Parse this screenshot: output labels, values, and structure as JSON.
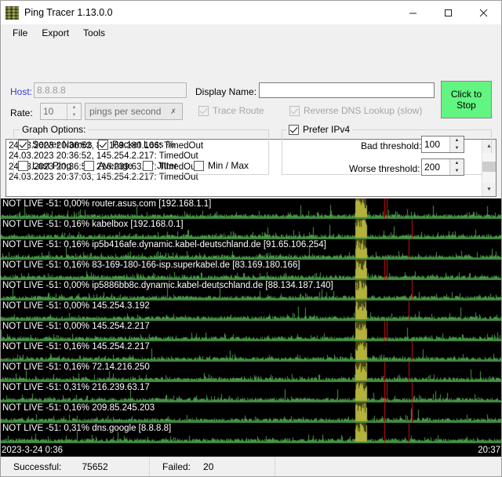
{
  "window": {
    "title": "Ping Tracer 1.13.0.0",
    "icon": "app-icon",
    "minimize_label": "minimize-icon",
    "maximize_label": "maximize-icon",
    "close_label": "close-icon"
  },
  "menu": {
    "items": [
      {
        "label": "File"
      },
      {
        "label": "Export"
      },
      {
        "label": "Tools"
      }
    ]
  },
  "form": {
    "host_label": "Host:",
    "host_value": "8.8.8.8",
    "host_placeholder": "",
    "rate_label": "Rate:",
    "rate_value": "10",
    "rate_unit": "pings per second",
    "display_name_label": "Display Name:",
    "display_name_value": "",
    "display_name_placeholder": "",
    "trace_route_label": "Trace Route",
    "reverse_dns_label": "Reverse DNS Lookup (slow)",
    "prefer_ipv4_label": "Prefer IPv4",
    "stop_button_line1": "Click to",
    "stop_button_line2": "Stop",
    "stop_button_color": "#63f582",
    "graph_options_label": "Graph Options:",
    "checkboxes": [
      {
        "label": "Server Names",
        "checked": true
      },
      {
        "label": "Packet Loss %",
        "checked": true
      },
      {
        "label": "Last Ping",
        "checked": false
      },
      {
        "label": "Average",
        "checked": false
      },
      {
        "label": "Jitter",
        "checked": false
      },
      {
        "label": "Min / Max",
        "checked": false
      }
    ],
    "bad_threshold_label": "Bad threshold:",
    "bad_threshold_value": "100",
    "worse_threshold_label": "Worse threshold:",
    "worse_threshold_value": "200"
  },
  "log": {
    "lines": [
      "24.03.2023 20:36:52, 83.169.180.166: TimedOut",
      "24.03.2023 20:36:52, 145.254.2.217: TimedOut",
      "24.03.2023 20:36:52, 216.239.63.17: TimedOut",
      "24.03.2023 20:37:03, 145.254.2.217: TimedOut"
    ],
    "scroll_up": "scroll-up-icon",
    "scroll_down": "scroll-down-icon"
  },
  "graph": {
    "background": "#000000",
    "trace_color": "#4a9a4a",
    "timeout_marker_color": "#cc1111",
    "rows": [
      {
        "label": "NOT LIVE -51: 0,00% router.asus.com [192.168.1.1]"
      },
      {
        "label": "NOT LIVE -51: 0,16% kabelbox [192.168.0.1]"
      },
      {
        "label": "NOT LIVE -51: 0,16% ip5b416afe.dynamic.kabel-deutschland.de [91.65.106.254]"
      },
      {
        "label": "NOT LIVE -51: 0,16% 83-169-180-166-isp.superkabel.de [83.169.180.166]"
      },
      {
        "label": "NOT LIVE -51: 0,00% ip5886bb8c.dynamic.kabel-deutschland.de [88.134.187.140]"
      },
      {
        "label": "NOT LIVE -51: 0,00% 145.254.3.192"
      },
      {
        "label": "NOT LIVE -51: 0,00% 145.254.2.217"
      },
      {
        "label": "NOT LIVE -51: 0,16% 145.254.2.217"
      },
      {
        "label": "NOT LIVE -51: 0,16% 72.14.216.250"
      },
      {
        "label": "NOT LIVE -51: 0,31% 216.239.63.17"
      },
      {
        "label": "NOT LIVE -51: 0,16% 209.85.245.203"
      },
      {
        "label": "NOT LIVE -51: 0,31% dns.google [8.8.8.8]"
      }
    ]
  },
  "time_axis": {
    "start": "2023-3-24 0:36",
    "end": "20:37"
  },
  "status": {
    "successful_label": "Successful:",
    "successful_value": "75652",
    "failed_label": "Failed:",
    "failed_value": "20"
  }
}
